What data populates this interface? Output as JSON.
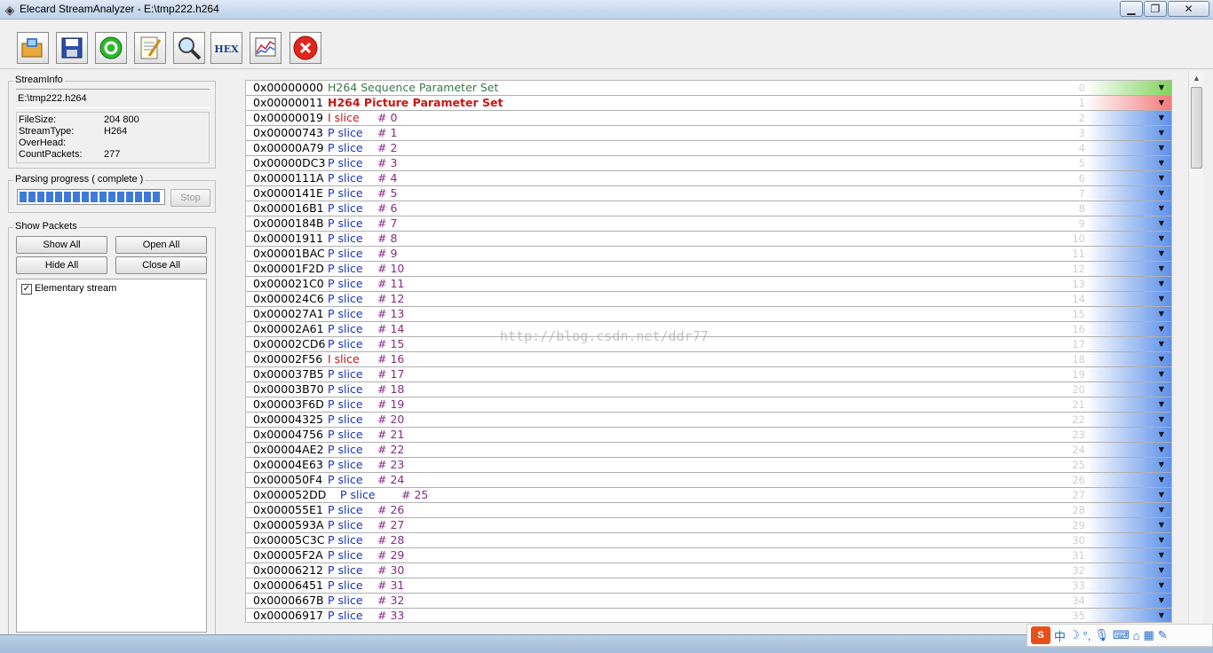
{
  "window": {
    "title": "Elecard StreamAnalyzer - E:\\tmp222.h264"
  },
  "toolbar": {
    "buttons": [
      {
        "name": "open-file-button",
        "icon": "open-folder-icon"
      },
      {
        "name": "save-button",
        "icon": "floppy-disk-icon"
      },
      {
        "name": "refresh-button",
        "icon": "refresh-icon"
      },
      {
        "name": "edit-button",
        "icon": "notepad-icon"
      },
      {
        "name": "search-button",
        "icon": "magnifier-icon"
      },
      {
        "name": "hex-view-button",
        "icon": "hex-icon",
        "label": "HEX"
      },
      {
        "name": "chart-button",
        "icon": "chart-icon"
      },
      {
        "name": "stop-button",
        "icon": "close-icon"
      }
    ]
  },
  "stream_info": {
    "title": "StreamInfo",
    "file": "E:\\tmp222.h264",
    "rows": [
      {
        "label": "FileSize:",
        "value": "204 800"
      },
      {
        "label": "StreamType:",
        "value": "H264"
      },
      {
        "label": "OverHead:",
        "value": ""
      },
      {
        "label": "CountPackets:",
        "value": "277"
      }
    ]
  },
  "parsing": {
    "title": "Parsing progress ( complete )",
    "progress": 1.0,
    "stop_label": "Stop"
  },
  "show_packets": {
    "title": "Show Packets",
    "show_all": "Show All",
    "open_all": "Open All",
    "hide_all": "Hide All",
    "close_all": "Close All",
    "tree_item": "Elementary stream",
    "tree_checked": true
  },
  "packets": [
    {
      "addr": "0x00000000",
      "type": "H264 Sequence Parameter Set",
      "num": "",
      "idx": "0",
      "kind": "sps"
    },
    {
      "addr": "0x00000011",
      "type": "H264 Picture Parameter Set",
      "num": "",
      "idx": "1",
      "kind": "pps"
    },
    {
      "addr": "0x00000019",
      "type": "I  slice",
      "num": "# 0",
      "idx": "2",
      "kind": "i"
    },
    {
      "addr": "0x00000743",
      "type": "P slice",
      "num": "# 1",
      "idx": "3",
      "kind": "p"
    },
    {
      "addr": "0x00000A79",
      "type": "P slice",
      "num": "# 2",
      "idx": "4",
      "kind": "p"
    },
    {
      "addr": "0x00000DC3",
      "type": "P slice",
      "num": "# 3",
      "idx": "5",
      "kind": "p"
    },
    {
      "addr": "0x0000111A",
      "type": "P slice",
      "num": "# 4",
      "idx": "6",
      "kind": "p"
    },
    {
      "addr": "0x0000141E",
      "type": "P slice",
      "num": "# 5",
      "idx": "7",
      "kind": "p"
    },
    {
      "addr": "0x000016B1",
      "type": "P slice",
      "num": "# 6",
      "idx": "8",
      "kind": "p"
    },
    {
      "addr": "0x0000184B",
      "type": "P slice",
      "num": "# 7",
      "idx": "9",
      "kind": "p"
    },
    {
      "addr": "0x00001911",
      "type": "P slice",
      "num": "# 8",
      "idx": "10",
      "kind": "p"
    },
    {
      "addr": "0x00001BAC",
      "type": "P slice",
      "num": "# 9",
      "idx": "11",
      "kind": "p"
    },
    {
      "addr": "0x00001F2D",
      "type": "P slice",
      "num": "# 10",
      "idx": "12",
      "kind": "p"
    },
    {
      "addr": "0x000021C0",
      "type": "P slice",
      "num": "# 11",
      "idx": "13",
      "kind": "p"
    },
    {
      "addr": "0x000024C6",
      "type": "P slice",
      "num": "# 12",
      "idx": "14",
      "kind": "p"
    },
    {
      "addr": "0x000027A1",
      "type": "P slice",
      "num": "# 13",
      "idx": "15",
      "kind": "p"
    },
    {
      "addr": "0x00002A61",
      "type": "P slice",
      "num": "# 14",
      "idx": "16",
      "kind": "p"
    },
    {
      "addr": "0x00002CD6",
      "type": "P slice",
      "num": "# 15",
      "idx": "17",
      "kind": "p"
    },
    {
      "addr": "0x00002F56",
      "type": "I  slice",
      "num": "# 16",
      "idx": "18",
      "kind": "i"
    },
    {
      "addr": "0x000037B5",
      "type": "P slice",
      "num": "# 17",
      "idx": "19",
      "kind": "p"
    },
    {
      "addr": "0x00003B70",
      "type": "P slice",
      "num": "# 18",
      "idx": "20",
      "kind": "p"
    },
    {
      "addr": "0x00003F6D",
      "type": "P slice",
      "num": "# 19",
      "idx": "21",
      "kind": "p"
    },
    {
      "addr": "0x00004325",
      "type": "P slice",
      "num": "# 20",
      "idx": "22",
      "kind": "p"
    },
    {
      "addr": "0x00004756",
      "type": "P slice",
      "num": "# 21",
      "idx": "23",
      "kind": "p"
    },
    {
      "addr": "0x00004AE2",
      "type": "P slice",
      "num": "# 22",
      "idx": "24",
      "kind": "p"
    },
    {
      "addr": "0x00004E63",
      "type": "P slice",
      "num": "# 23",
      "idx": "25",
      "kind": "p"
    },
    {
      "addr": "0x000050F4",
      "type": "P slice",
      "num": "# 24",
      "idx": "26",
      "kind": "p"
    },
    {
      "addr": "0x000052DD",
      "type": "P slice",
      "num": "# 25",
      "idx": "27",
      "kind": "p2"
    },
    {
      "addr": "0x000055E1",
      "type": "P slice",
      "num": "# 26",
      "idx": "28",
      "kind": "p"
    },
    {
      "addr": "0x0000593A",
      "type": "P slice",
      "num": "# 27",
      "idx": "29",
      "kind": "p"
    },
    {
      "addr": "0x00005C3C",
      "type": "P slice",
      "num": "# 28",
      "idx": "30",
      "kind": "p"
    },
    {
      "addr": "0x00005F2A",
      "type": "P slice",
      "num": "# 29",
      "idx": "31",
      "kind": "p"
    },
    {
      "addr": "0x00006212",
      "type": "P slice",
      "num": "# 30",
      "idx": "32",
      "kind": "p"
    },
    {
      "addr": "0x00006451",
      "type": "P slice",
      "num": "# 31",
      "idx": "33",
      "kind": "p"
    },
    {
      "addr": "0x0000667B",
      "type": "P slice",
      "num": "# 32",
      "idx": "34",
      "kind": "p"
    },
    {
      "addr": "0x00006917",
      "type": "P slice",
      "num": "# 33",
      "idx": "35",
      "kind": "p"
    }
  ],
  "colors": {
    "sps": "#3a7a4a",
    "pps": "#cc1414",
    "i_slice": "#cc1414",
    "p_slice": "#1a33b8",
    "number": "#8a2a8a",
    "sps_bar": "#7fd35a",
    "pps_bar": "#f07878",
    "slice_bar": "#5b8fe8"
  },
  "watermark": "http://blog.csdn.net/ddr77",
  "ime": {
    "logo": "S",
    "lang": "中"
  }
}
